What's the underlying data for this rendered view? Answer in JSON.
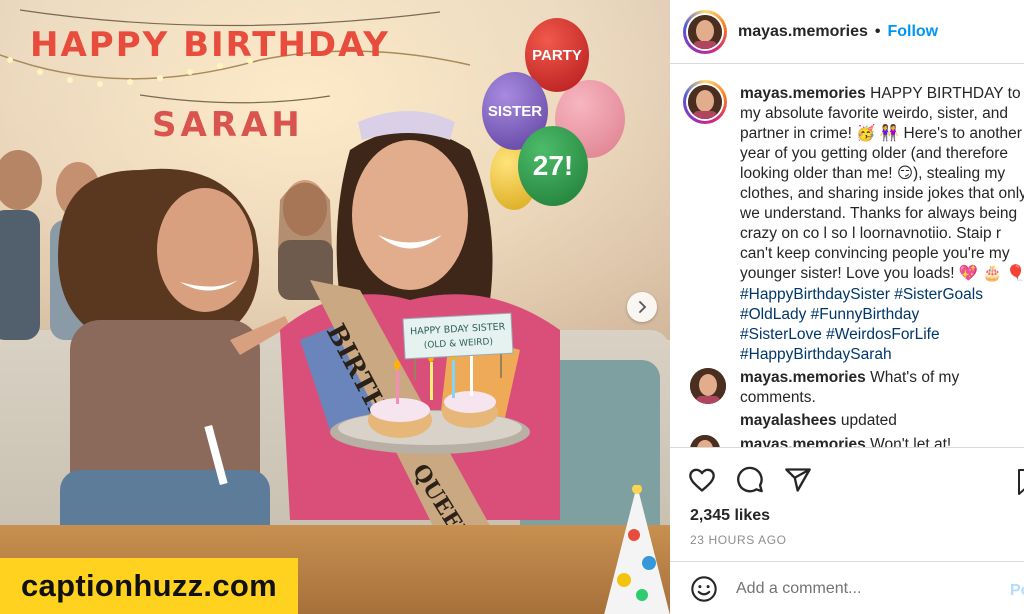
{
  "photo": {
    "banner_line1": "HAPPY BIRTHDAY",
    "banner_line2": "SARAH",
    "balloon_party": "PARTY",
    "balloon_sister": "SISTER",
    "balloon_27": "27!",
    "sash_top": "BIRTH",
    "sash_bottom": "QUEEN",
    "cake_sign_line1": "HAPPY BDAY SISTER",
    "cake_sign_line2": "(OLD & WEIRD)",
    "watermark": "captionhuzz.com"
  },
  "header": {
    "username": "mayas.memories",
    "separator": "•",
    "follow_label": "Follow"
  },
  "caption": {
    "username": "mayas.memories",
    "text": "HAPPY BIRTHDAY to my absolute favorite weirdo, sister, and partner in crime! 🥳 👭 Here's to another year of you getting older (and therefore looking older than me! 😏), stealing my clothes, and sharing inside jokes that only we understand. Thanks for always being crazy on co l so l loornavnotiio. Staip r can't keep convincing people you're my younger sister! Love you loads! 💖 🎂 🎈",
    "hashtags": [
      "#HappyBirthdaySister #SisterGoals",
      "#OldLady #FunnyBirthday",
      "#SisterLove #WeirdosForLife",
      "#HappyBirthdaySarah"
    ]
  },
  "comments": [
    {
      "username": "mayas.memories",
      "text": "What's of my comments."
    },
    {
      "username": "mayalashees",
      "text": "updated"
    },
    {
      "username": "mayas.memories",
      "text": "Won't let at!"
    }
  ],
  "actions": {
    "likes": "2,345 likes",
    "time_ago": "23 HOURS AGO",
    "comment_placeholder": "Add a comment...",
    "post_label": "Post"
  },
  "colors": {
    "follow_blue": "#0095f6",
    "hashtag_blue": "#00376b",
    "watermark_yellow": "#ffd21f",
    "post_disabled": "#b3dbff"
  },
  "icons": [
    "heart-icon",
    "comment-icon",
    "share-icon",
    "bookmark-icon",
    "emoji-icon",
    "chevron-right-icon"
  ]
}
